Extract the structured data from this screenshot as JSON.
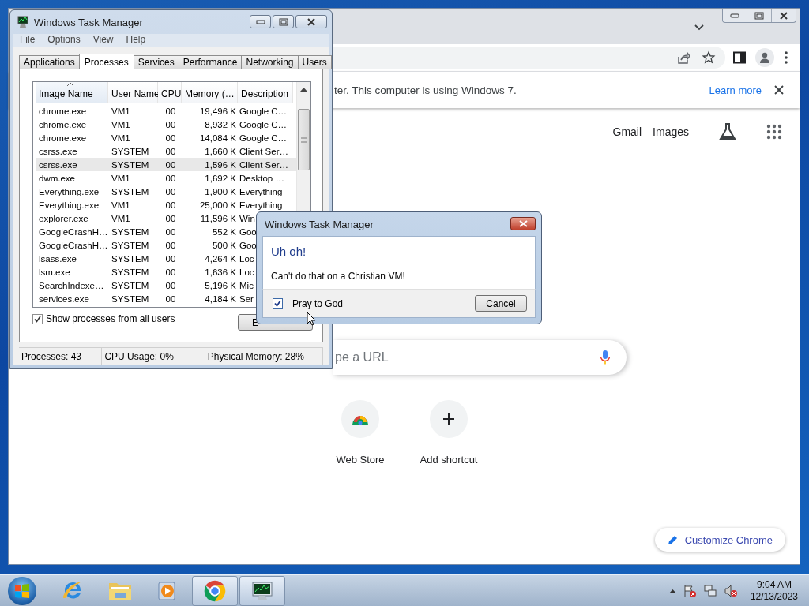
{
  "chrome": {
    "infobar": {
      "message": "ter. This computer is using Windows 7.",
      "link": "Learn more"
    },
    "header_links": [
      "Gmail",
      "Images"
    ],
    "search": {
      "placeholder": "pe a URL"
    },
    "shortcuts": [
      {
        "label": "Web Store",
        "kind": "webstore"
      },
      {
        "label": "Add shortcut",
        "kind": "add"
      }
    ],
    "customize_button": "Customize Chrome"
  },
  "task_manager": {
    "title": "Windows Task Manager",
    "menu": [
      "File",
      "Options",
      "View",
      "Help"
    ],
    "tabs": [
      {
        "label": "Applications",
        "selected": false
      },
      {
        "label": "Processes",
        "selected": true
      },
      {
        "label": "Services",
        "selected": false
      },
      {
        "label": "Performance",
        "selected": false
      },
      {
        "label": "Networking",
        "selected": false
      },
      {
        "label": "Users",
        "selected": false
      }
    ],
    "columns": [
      {
        "label": "Image Name",
        "sorted": true
      },
      {
        "label": "User Name",
        "sorted": false
      },
      {
        "label": "CPU",
        "sorted": false
      },
      {
        "label": "Memory (…",
        "sorted": false
      },
      {
        "label": "Description",
        "sorted": false
      }
    ],
    "rows": [
      {
        "cells": [
          "chrome.exe",
          "VM1",
          "00",
          "19,496 K",
          "Google C…"
        ],
        "selected": false
      },
      {
        "cells": [
          "chrome.exe",
          "VM1",
          "00",
          "8,932 K",
          "Google C…"
        ],
        "selected": false
      },
      {
        "cells": [
          "chrome.exe",
          "VM1",
          "00",
          "14,084 K",
          "Google C…"
        ],
        "selected": false
      },
      {
        "cells": [
          "csrss.exe",
          "SYSTEM",
          "00",
          "1,660 K",
          "Client Ser…"
        ],
        "selected": false
      },
      {
        "cells": [
          "csrss.exe",
          "SYSTEM",
          "00",
          "1,596 K",
          "Client Ser…"
        ],
        "selected": true
      },
      {
        "cells": [
          "dwm.exe",
          "VM1",
          "00",
          "1,692 K",
          "Desktop …"
        ],
        "selected": false
      },
      {
        "cells": [
          "Everything.exe",
          "SYSTEM",
          "00",
          "1,900 K",
          "Everything"
        ],
        "selected": false
      },
      {
        "cells": [
          "Everything.exe",
          "VM1",
          "00",
          "25,000 K",
          "Everything"
        ],
        "selected": false
      },
      {
        "cells": [
          "explorer.exe",
          "VM1",
          "00",
          "11,596 K",
          "Win"
        ],
        "selected": false
      },
      {
        "cells": [
          "GoogleCrashH…",
          "SYSTEM",
          "00",
          "552 K",
          "Goo"
        ],
        "selected": false
      },
      {
        "cells": [
          "GoogleCrashH…",
          "SYSTEM",
          "00",
          "500 K",
          "Goo"
        ],
        "selected": false
      },
      {
        "cells": [
          "lsass.exe",
          "SYSTEM",
          "00",
          "4,264 K",
          "Loc"
        ],
        "selected": false
      },
      {
        "cells": [
          "lsm.exe",
          "SYSTEM",
          "00",
          "1,636 K",
          "Loc"
        ],
        "selected": false
      },
      {
        "cells": [
          "SearchIndexe…",
          "SYSTEM",
          "00",
          "5,196 K",
          "Mic"
        ],
        "selected": false
      },
      {
        "cells": [
          "services.exe",
          "SYSTEM",
          "00",
          "4,184 K",
          "Ser"
        ],
        "selected": false
      }
    ],
    "show_all_users": {
      "label": "Show processes from all users",
      "checked": true
    },
    "end_button": "E",
    "status": [
      "Processes: 43",
      "CPU Usage: 0%",
      "Physical Memory: 28%"
    ]
  },
  "dialog": {
    "title": "Windows Task Manager",
    "heading": "Uh oh!",
    "message": "Can't do that on a Christian VM!",
    "checkbox": {
      "label": "Pray to God",
      "checked": true
    },
    "button": "Cancel"
  },
  "taskbar": {
    "apps": [
      {
        "kind": "ie",
        "running": false
      },
      {
        "kind": "explorer",
        "running": false
      },
      {
        "kind": "media",
        "running": false
      },
      {
        "kind": "chrome",
        "running": true
      },
      {
        "kind": "taskmgr",
        "running": true
      }
    ],
    "clock": {
      "time": "9:04 AM",
      "date": "12/13/2023"
    }
  }
}
